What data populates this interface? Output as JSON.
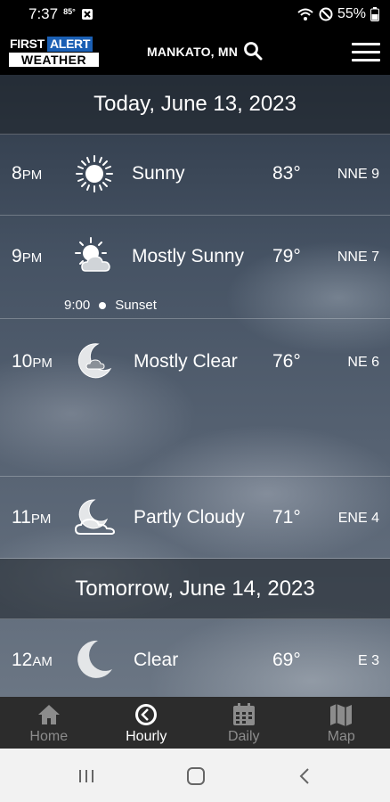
{
  "status": {
    "time": "7:37",
    "temp_badge": "85°",
    "battery": "55%"
  },
  "app": {
    "logo_first": "FIRST",
    "logo_alert": "ALERT",
    "logo_weather": "WEATHER",
    "location": "MANKATO, MN"
  },
  "sections": [
    {
      "date": "Today, June 13, 2023"
    },
    {
      "date": "Tomorrow, June 14, 2023"
    }
  ],
  "hours": [
    {
      "time": "8",
      "ampm": "PM",
      "icon": "sun-icon",
      "condition": "Sunny",
      "temp": "83°",
      "wind": "NNE 9"
    },
    {
      "time": "9",
      "ampm": "PM",
      "icon": "partly-sunny-icon",
      "condition": "Mostly Sunny",
      "temp": "79°",
      "wind": "NNE 7"
    },
    {
      "time": "10",
      "ampm": "PM",
      "icon": "moon-cloud-icon",
      "condition": "Mostly Clear",
      "temp": "76°",
      "wind": "NE 6"
    },
    {
      "time": "11",
      "ampm": "PM",
      "icon": "moon-cloud-icon",
      "condition": "Partly Cloudy",
      "temp": "71°",
      "wind": "ENE 4"
    },
    {
      "time": "12",
      "ampm": "AM",
      "icon": "moon-icon",
      "condition": "Clear",
      "temp": "69°",
      "wind": "E 3"
    }
  ],
  "sunset": {
    "time": "9:00",
    "label": "Sunset"
  },
  "nav": {
    "home": "Home",
    "hourly": "Hourly",
    "daily": "Daily",
    "map": "Map"
  }
}
